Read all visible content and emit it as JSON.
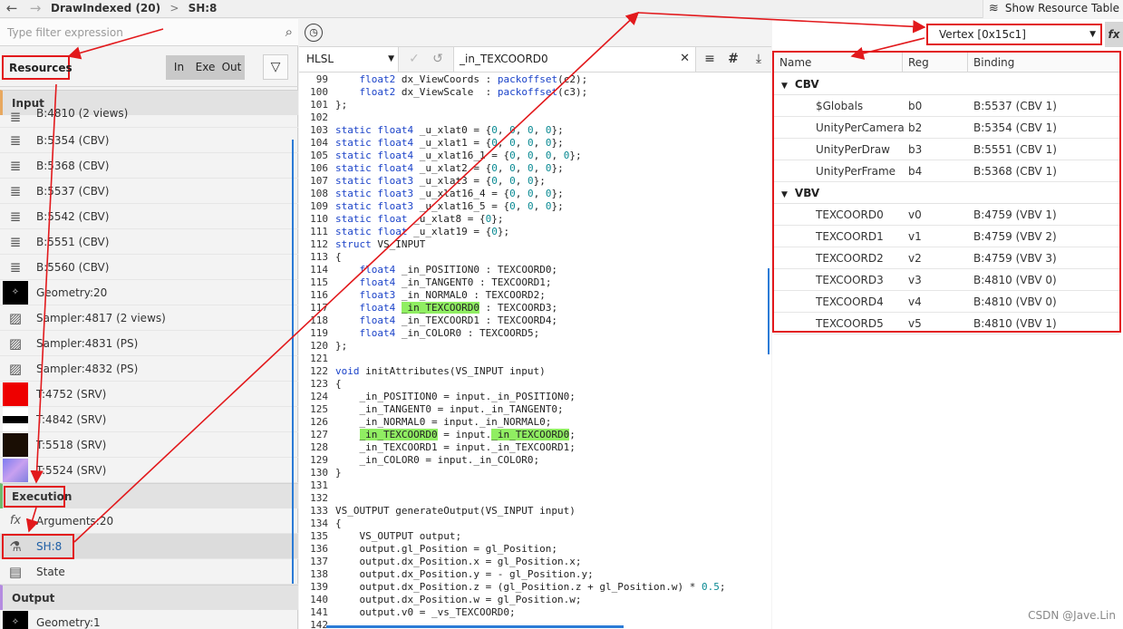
{
  "topbar": {
    "back": "←",
    "forward": "→",
    "crumb1": "DrawIndexed (20)",
    "sep": ">",
    "crumb2": "SH:8",
    "show_resource_table": "Show Resource Table"
  },
  "left": {
    "filter_placeholder": "Type filter expression",
    "resources_label": "Resources",
    "toggles": [
      "In",
      "Exe",
      "Out"
    ],
    "sections": {
      "input": "Input",
      "execution": "Execution",
      "output": "Output"
    },
    "input_items": [
      {
        "label": "B:4810 (2 views)",
        "icon": "database-icon"
      },
      {
        "label": "B:5354 (CBV)",
        "icon": "database-icon"
      },
      {
        "label": "B:5368 (CBV)",
        "icon": "database-icon"
      },
      {
        "label": "B:5537 (CBV)",
        "icon": "database-icon"
      },
      {
        "label": "B:5542 (CBV)",
        "icon": "database-icon"
      },
      {
        "label": "B:5551 (CBV)",
        "icon": "database-icon"
      },
      {
        "label": "B:5560 (CBV)",
        "icon": "database-icon"
      },
      {
        "label": "Geometry:20",
        "icon": "geometry-thumbnail"
      },
      {
        "label": "Sampler:4817 (2 views)",
        "icon": "image-icon"
      },
      {
        "label": "Sampler:4831 (PS)",
        "icon": "image-icon"
      },
      {
        "label": "Sampler:4832 (PS)",
        "icon": "image-icon"
      },
      {
        "label": "T:4752 (SRV)",
        "icon": "texture-thumbnail"
      },
      {
        "label": "T:4842 (SRV)",
        "icon": "texture-thumbnail"
      },
      {
        "label": "T:5518 (SRV)",
        "icon": "texture-thumbnail"
      },
      {
        "label": "T:5524 (SRV)",
        "icon": "texture-thumbnail"
      }
    ],
    "execution_items": [
      {
        "label": "Arguments:20",
        "icon": "fx-icon"
      },
      {
        "label": "SH:8",
        "icon": "shader-icon"
      },
      {
        "label": "State",
        "icon": "document-icon"
      }
    ],
    "output_items": [
      {
        "label": "Geometry:1",
        "icon": "geometry-thumbnail"
      }
    ]
  },
  "middle": {
    "language": "HLSL",
    "search_value": "_in_TEXCOORD0",
    "code": [
      {
        "n": "99",
        "t": "    float2 dx_ViewCoords : packoffset(c2);"
      },
      {
        "n": "100",
        "t": "    float2 dx_ViewScale  : packoffset(c3);"
      },
      {
        "n": "101",
        "t": "};"
      },
      {
        "n": "102",
        "t": ""
      },
      {
        "n": "103",
        "t": "static float4 _u_xlat0 = {0, 0, 0, 0};"
      },
      {
        "n": "104",
        "t": "static float4 _u_xlat1 = {0, 0, 0, 0};"
      },
      {
        "n": "105",
        "t": "static float4 _u_xlat16_1 = {0, 0, 0, 0};"
      },
      {
        "n": "106",
        "t": "static float4 _u_xlat2 = {0, 0, 0, 0};"
      },
      {
        "n": "107",
        "t": "static float3 _u_xlat3 = {0, 0, 0};"
      },
      {
        "n": "108",
        "t": "static float3 _u_xlat16_4 = {0, 0, 0};"
      },
      {
        "n": "109",
        "t": "static float3 _u_xlat16_5 = {0, 0, 0};"
      },
      {
        "n": "110",
        "t": "static float _u_xlat8 = {0};"
      },
      {
        "n": "111",
        "t": "static float _u_xlat19 = {0};"
      },
      {
        "n": "112",
        "t": "struct VS_INPUT"
      },
      {
        "n": "113",
        "t": "{"
      },
      {
        "n": "114",
        "t": "    float4 _in_POSITION0 : TEXCOORD0;"
      },
      {
        "n": "115",
        "t": "    float4 _in_TANGENT0 : TEXCOORD1;"
      },
      {
        "n": "116",
        "t": "    float3 _in_NORMAL0 : TEXCOORD2;"
      },
      {
        "n": "117",
        "t": "    float4 _in_TEXCOORD0 : TEXCOORD3;"
      },
      {
        "n": "118",
        "t": "    float4 _in_TEXCOORD1 : TEXCOORD4;"
      },
      {
        "n": "119",
        "t": "    float4 _in_COLOR0 : TEXCOORD5;"
      },
      {
        "n": "120",
        "t": "};"
      },
      {
        "n": "121",
        "t": ""
      },
      {
        "n": "122",
        "t": "void initAttributes(VS_INPUT input)"
      },
      {
        "n": "123",
        "t": "{"
      },
      {
        "n": "124",
        "t": "    _in_POSITION0 = input._in_POSITION0;"
      },
      {
        "n": "125",
        "t": "    _in_TANGENT0 = input._in_TANGENT0;"
      },
      {
        "n": "126",
        "t": "    _in_NORMAL0 = input._in_NORMAL0;"
      },
      {
        "n": "127",
        "t": "    _in_TEXCOORD0 = input._in_TEXCOORD0;"
      },
      {
        "n": "128",
        "t": "    _in_TEXCOORD1 = input._in_TEXCOORD1;"
      },
      {
        "n": "129",
        "t": "    _in_COLOR0 = input._in_COLOR0;"
      },
      {
        "n": "130",
        "t": "}"
      },
      {
        "n": "131",
        "t": ""
      },
      {
        "n": "132",
        "t": ""
      },
      {
        "n": "133",
        "t": "VS_OUTPUT generateOutput(VS_INPUT input)"
      },
      {
        "n": "134",
        "t": "{"
      },
      {
        "n": "135",
        "t": "    VS_OUTPUT output;"
      },
      {
        "n": "136",
        "t": "    output.gl_Position = gl_Position;"
      },
      {
        "n": "137",
        "t": "    output.dx_Position.x = gl_Position.x;"
      },
      {
        "n": "138",
        "t": "    output.dx_Position.y = - gl_Position.y;"
      },
      {
        "n": "139",
        "t": "    output.dx_Position.z = (gl_Position.z + gl_Position.w) * 0.5;"
      },
      {
        "n": "140",
        "t": "    output.dx_Position.w = gl_Position.w;"
      },
      {
        "n": "141",
        "t": "    output.v0 = _vs_TEXCOORD0;"
      },
      {
        "n": "142",
        "t": ""
      }
    ]
  },
  "right": {
    "stage": "Vertex [0x15c1]",
    "fx": "fx",
    "headers": [
      "Name",
      "Reg",
      "Binding"
    ],
    "groups": [
      {
        "name": "CBV",
        "rows": [
          [
            "$Globals",
            "b0",
            "B:5537 (CBV 1)"
          ],
          [
            "UnityPerCamera",
            "b2",
            "B:5354 (CBV 1)"
          ],
          [
            "UnityPerDraw",
            "b3",
            "B:5551 (CBV 1)"
          ],
          [
            "UnityPerFrame",
            "b4",
            "B:5368 (CBV 1)"
          ]
        ]
      },
      {
        "name": "VBV",
        "rows": [
          [
            "TEXCOORD0",
            "v0",
            "B:4759 (VBV 1)"
          ],
          [
            "TEXCOORD1",
            "v1",
            "B:4759 (VBV 2)"
          ],
          [
            "TEXCOORD2",
            "v2",
            "B:4759 (VBV 3)"
          ],
          [
            "TEXCOORD3",
            "v3",
            "B:4810 (VBV 0)"
          ],
          [
            "TEXCOORD4",
            "v4",
            "B:4810 (VBV 0)"
          ],
          [
            "TEXCOORD5",
            "v5",
            "B:4810 (VBV 1)"
          ]
        ]
      }
    ]
  },
  "watermark": "CSDN @Jave.Lin",
  "colors": {
    "annotation": "#e2191c",
    "highlight": "#90ee62",
    "keyword": "#1b43c9",
    "number": "#0a8a93"
  }
}
